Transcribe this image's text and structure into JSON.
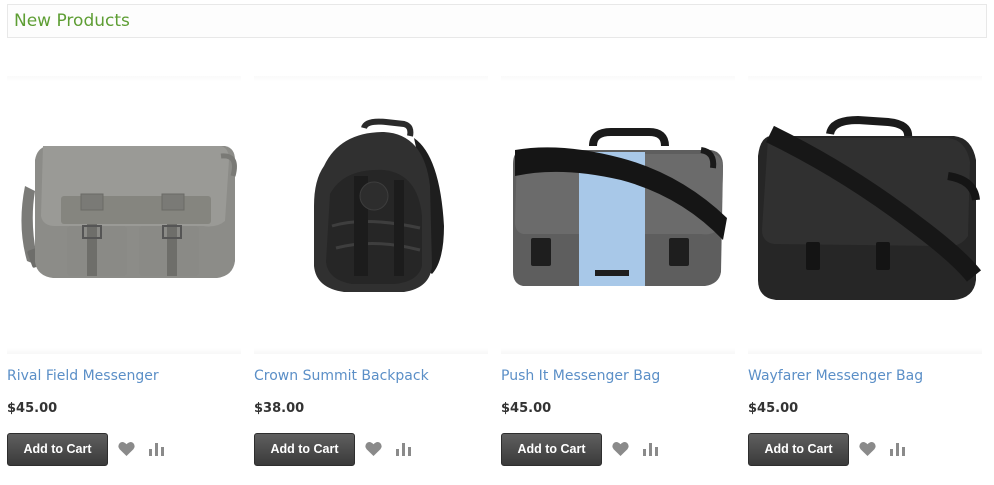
{
  "section": {
    "title": "New Products"
  },
  "colors": {
    "title": "#5e9e34",
    "product_link": "#5b8fc7",
    "button": "#4a4a4a",
    "icon": "#8a8a8a"
  },
  "products": [
    {
      "name": "Rival Field Messenger",
      "price": "$45.00",
      "add_to_cart": "Add to Cart",
      "image_icon": "messenger-bag-gray"
    },
    {
      "name": "Crown Summit Backpack",
      "price": "$38.00",
      "add_to_cart": "Add to Cart",
      "image_icon": "backpack-black"
    },
    {
      "name": "Push It Messenger Bag",
      "price": "$45.00",
      "add_to_cart": "Add to Cart",
      "image_icon": "messenger-bag-gray-blue"
    },
    {
      "name": "Wayfarer Messenger Bag",
      "price": "$45.00",
      "add_to_cart": "Add to Cart",
      "image_icon": "messenger-bag-black"
    }
  ],
  "actions": {
    "wishlist_icon": "heart-icon",
    "compare_icon": "bar-chart-icon"
  }
}
